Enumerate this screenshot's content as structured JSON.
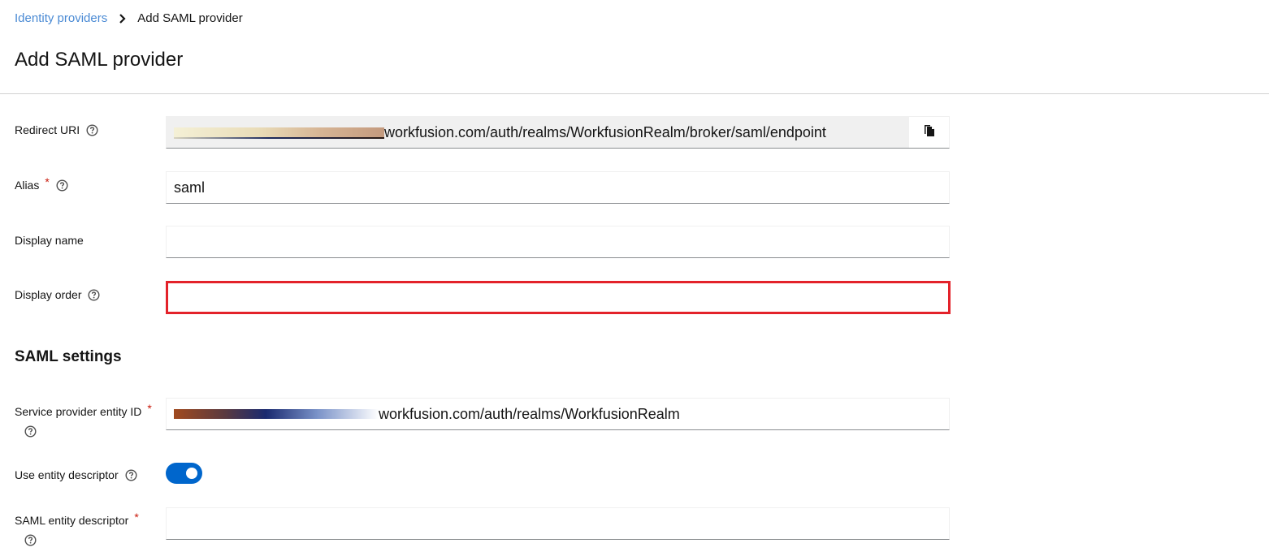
{
  "breadcrumb": {
    "parent": "Identity providers",
    "current": "Add SAML provider"
  },
  "page_title": "Add SAML provider",
  "form": {
    "redirect_uri": {
      "label": "Redirect URI",
      "value_suffix": "workfusion.com/auth/realms/WorkfusionRealm/broker/saml/endpoint",
      "copy_icon": "copy-icon"
    },
    "alias": {
      "label": "Alias",
      "required_mark": "*",
      "value": "saml"
    },
    "display_name": {
      "label": "Display name",
      "value": ""
    },
    "display_order": {
      "label": "Display order",
      "value": "",
      "error_color": "#e3222a"
    }
  },
  "saml_settings": {
    "title": "SAML settings",
    "service_provider_entity_id": {
      "label": "Service provider entity ID",
      "required_mark": "*",
      "value_suffix": "workfusion.com/auth/realms/WorkfusionRealm"
    },
    "use_entity_descriptor": {
      "label": "Use entity descriptor",
      "enabled": true
    },
    "saml_entity_descriptor": {
      "label": "SAML entity descriptor",
      "required_mark": "*",
      "value": ""
    }
  },
  "colors": {
    "link": "#4a8ad4",
    "toggle_on": "#0066cc",
    "required": "#c9190b"
  }
}
